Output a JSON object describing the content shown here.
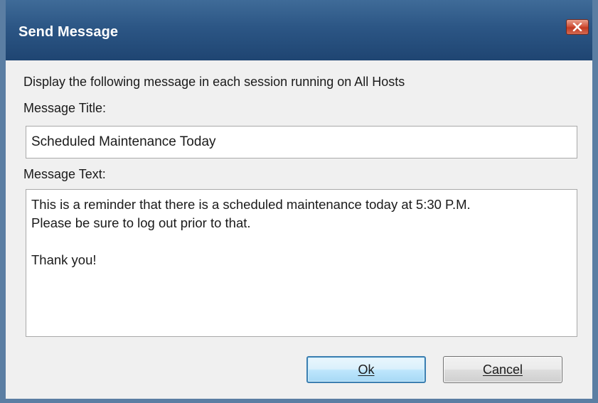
{
  "window": {
    "title": "Send Message",
    "close_icon": "close-icon"
  },
  "dialog": {
    "instruction": "Display the following message in each session running on All Hosts",
    "title_label": "Message Title:",
    "title_value": "Scheduled Maintenance Today",
    "text_label": "Message Text:",
    "text_lines": [
      "This is a reminder that there is a scheduled maintenance today at 5:30 P.M.",
      "Please be sure to log out prior to that.",
      "",
      "Thank you!"
    ]
  },
  "buttons": {
    "ok_label": "Ok",
    "cancel_label": "Cancel"
  },
  "colors": {
    "titlebar": "#2c5685",
    "close_button": "#c23a22",
    "ok_border": "#3c7fb1"
  }
}
